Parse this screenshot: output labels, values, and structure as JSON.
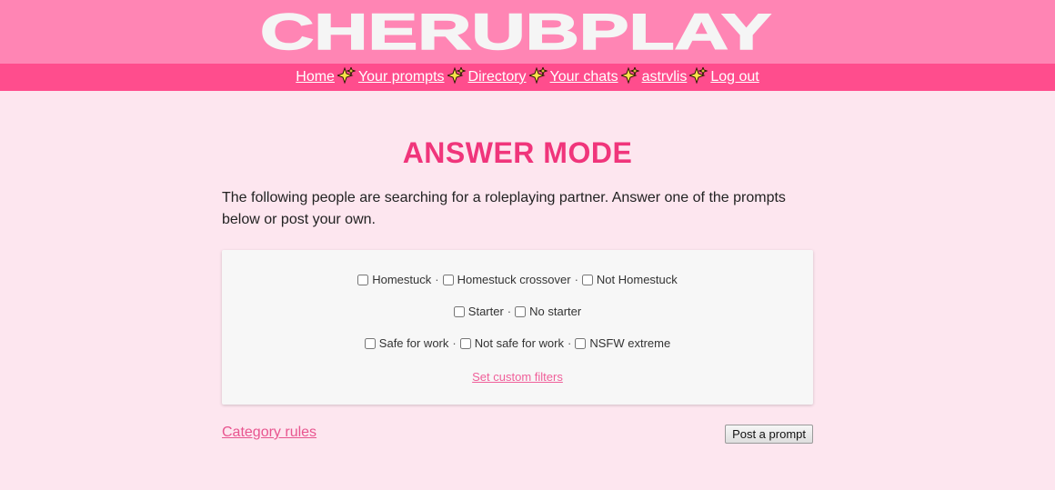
{
  "header": {
    "logo_text": "CHERUBPLAY",
    "logo_color": "#f5f5f5",
    "bar_color": "#ff85b4"
  },
  "nav": {
    "bar_color": "#ff4d8d",
    "separator_icon": "sparkles-icon",
    "items": [
      {
        "label": "Home"
      },
      {
        "label": "Your prompts"
      },
      {
        "label": "Directory"
      },
      {
        "label": "Your chats"
      },
      {
        "label": "astrvlis"
      },
      {
        "label": "Log out"
      }
    ]
  },
  "main": {
    "title": "ANSWER MODE",
    "title_color": "#f0357b",
    "intro": "The following people are searching for a roleplaying partner. Answer one of the prompts below or post your own.",
    "filters": {
      "rows": [
        [
          "Homestuck",
          "Homestuck crossover",
          "Not Homestuck"
        ],
        [
          "Starter",
          "No starter"
        ],
        [
          "Safe for work",
          "Not safe for work",
          "NSFW extreme"
        ]
      ],
      "custom_filters_label": "Set custom filters"
    },
    "category_rules_label": "Category rules",
    "post_prompt_label": "Post a prompt"
  }
}
